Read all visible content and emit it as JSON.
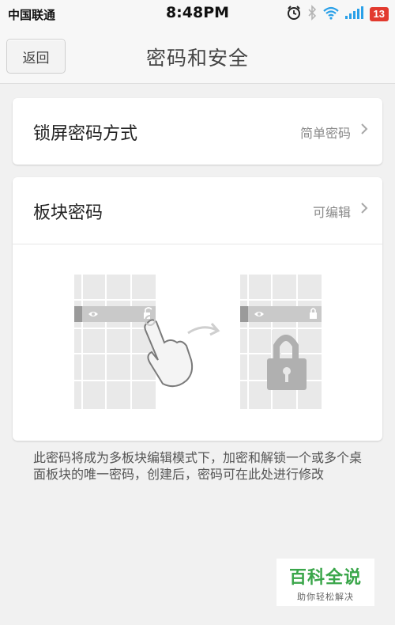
{
  "status_bar": {
    "carrier": "中国联通",
    "time": "8:48PM",
    "icons": [
      "alarm-icon",
      "bluetooth-icon",
      "wifi-icon",
      "signal-icon"
    ],
    "battery": "13",
    "battery_color": "#e23a2e"
  },
  "nav": {
    "back_label": "返回",
    "title": "密码和安全"
  },
  "lock_screen": {
    "label": "锁屏密码方式",
    "value": "简单密码"
  },
  "tile_password": {
    "label": "板块密码",
    "value": "可编辑"
  },
  "note": "此密码将成为多板块编辑模式下，加密和解锁一个或多个桌面板块的唯一密码，创建后，密码可在此处进行修改",
  "watermark": {
    "title": "百科全说",
    "subtitle": "助你轻松解决",
    "color": "#3aa64a"
  }
}
